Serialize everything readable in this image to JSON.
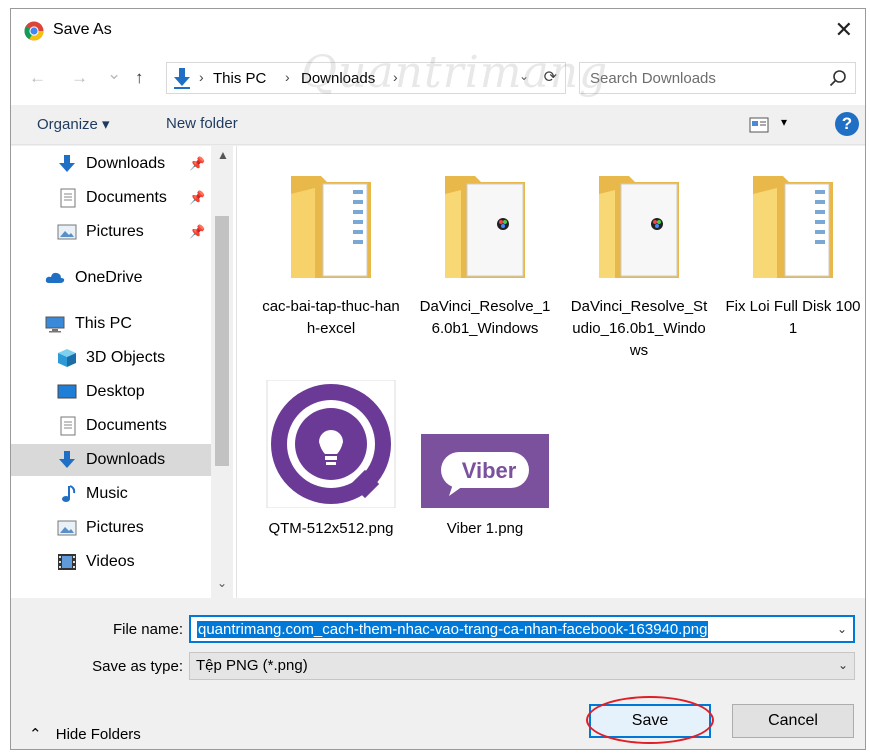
{
  "window": {
    "title": "Save As",
    "close_glyph": "✕"
  },
  "nav": {
    "back_glyph": "←",
    "forward_glyph": "→",
    "recent_glyph": "⌄",
    "up_glyph": "↑",
    "breadcrumbs": [
      "This PC",
      "Downloads"
    ],
    "crumb_sep": "›",
    "addr_drop_glyph": "⌄",
    "refresh_glyph": "⟳",
    "search_placeholder": "Search Downloads"
  },
  "toolbar": {
    "organize_label": "Organize ▾",
    "new_folder_label": "New folder",
    "view_drop_glyph": "▾",
    "help_glyph": "?"
  },
  "sidebar": {
    "items": [
      {
        "label": "Downloads",
        "icon": "download-arrow-icon",
        "pinned": true
      },
      {
        "label": "Documents",
        "icon": "document-icon",
        "pinned": true
      },
      {
        "label": "Pictures",
        "icon": "pictures-icon",
        "pinned": true
      },
      {
        "label": "OneDrive",
        "icon": "cloud-icon"
      },
      {
        "label": "This PC",
        "icon": "computer-icon"
      },
      {
        "label": "3D Objects",
        "icon": "cube-icon"
      },
      {
        "label": "Desktop",
        "icon": "desktop-icon"
      },
      {
        "label": "Documents",
        "icon": "document-icon"
      },
      {
        "label": "Downloads",
        "icon": "download-arrow-icon",
        "selected": true
      },
      {
        "label": "Music",
        "icon": "music-note-icon"
      },
      {
        "label": "Pictures",
        "icon": "pictures-icon"
      },
      {
        "label": "Videos",
        "icon": "film-icon"
      }
    ],
    "pin_glyph": "📌",
    "scroll_up_glyph": "▲",
    "scroll_down_glyph": "⌄"
  },
  "files": [
    {
      "name": "cac-bai-tap-thuc-hanh-excel",
      "kind": "folder-docs"
    },
    {
      "name": "DaVinci_Resolve_16.0b1_Windows",
      "kind": "folder-app"
    },
    {
      "name": "DaVinci_Resolve_Studio_16.0b1_Windows",
      "kind": "folder-app"
    },
    {
      "name": "Fix Loi Full Disk 100 1",
      "kind": "folder-docs"
    },
    {
      "name": "QTM-512x512.png",
      "kind": "image-qtm"
    },
    {
      "name": "Viber 1.png",
      "kind": "image-viber",
      "thumb_text": "Viber"
    }
  ],
  "form": {
    "file_name_label": "File name:",
    "file_name_value": "quantrimang.com_cach-them-nhac-vao-trang-ca-nhan-facebook-163940.png",
    "save_type_label": "Save as type:",
    "save_type_value": "Tệp PNG (*.png)",
    "drop_glyph": "⌄",
    "hide_folders_label": "Hide Folders",
    "hide_glyph": "⌃",
    "save_label": "Save",
    "cancel_label": "Cancel"
  },
  "colors": {
    "accent": "#0078d7",
    "folder": "#f8d775",
    "qtm_purple": "#6b3a96",
    "viber_purple": "#7b519d",
    "highlight_ring": "#e01e26"
  },
  "watermark": "Quantrimang"
}
